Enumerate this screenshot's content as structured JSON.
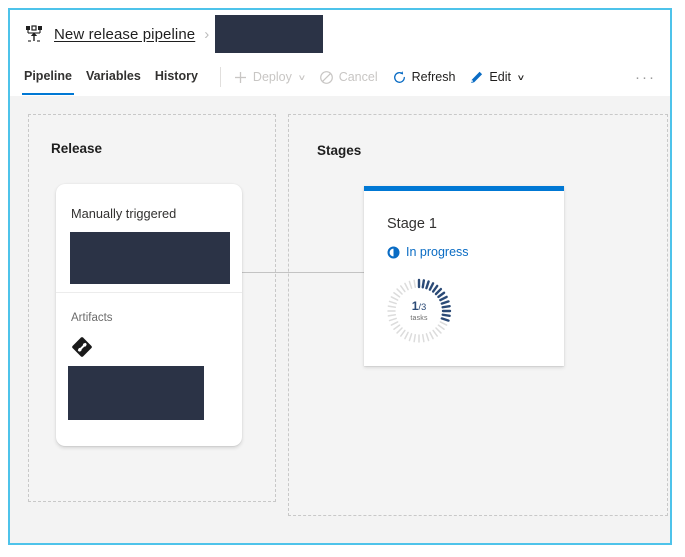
{
  "window": {
    "border_color": "#4ec3ea"
  },
  "breadcrumb": {
    "icon": "release-pipeline-icon",
    "title": "New release pipeline",
    "separator": "›",
    "redacted": ""
  },
  "tabs": [
    {
      "label": "Pipeline",
      "active": true
    },
    {
      "label": "Variables",
      "active": false
    },
    {
      "label": "History",
      "active": false
    }
  ],
  "toolbar": {
    "deploy_label": "Deploy",
    "deploy_icon": "plus-icon",
    "deploy_enabled": false,
    "cancel_label": "Cancel",
    "cancel_icon": "block-icon",
    "cancel_enabled": false,
    "refresh_label": "Refresh",
    "refresh_icon": "refresh-icon",
    "refresh_enabled": true,
    "edit_label": "Edit",
    "edit_icon": "pencil-icon",
    "edit_enabled": true,
    "caret": "∨",
    "overflow_label": "···",
    "accent_color": "#0078d4",
    "disabled_color": "#c8c6c4"
  },
  "release_panel": {
    "title": "Release",
    "card": {
      "trigger_label": "Manually triggered",
      "release_name_redacted": "",
      "artifacts_label": "Artifacts",
      "artifact_icon": "git-repo-icon",
      "artifact_name_redacted": ""
    }
  },
  "stages_panel": {
    "title": "Stages",
    "stage": {
      "name": "Stage 1",
      "status_icon": "in-progress-clock-icon",
      "status_text": "In progress",
      "status_color": "#0a6cc4",
      "top_bar_color": "#0078d4",
      "progress": {
        "completed": "1",
        "separator": "/",
        "total": "3",
        "label": "tasks",
        "ticks_total": 40,
        "ticks_done": 13,
        "tick_done_color": "#2b4a76",
        "tick_pending_color": "#dcdcdc"
      }
    }
  }
}
